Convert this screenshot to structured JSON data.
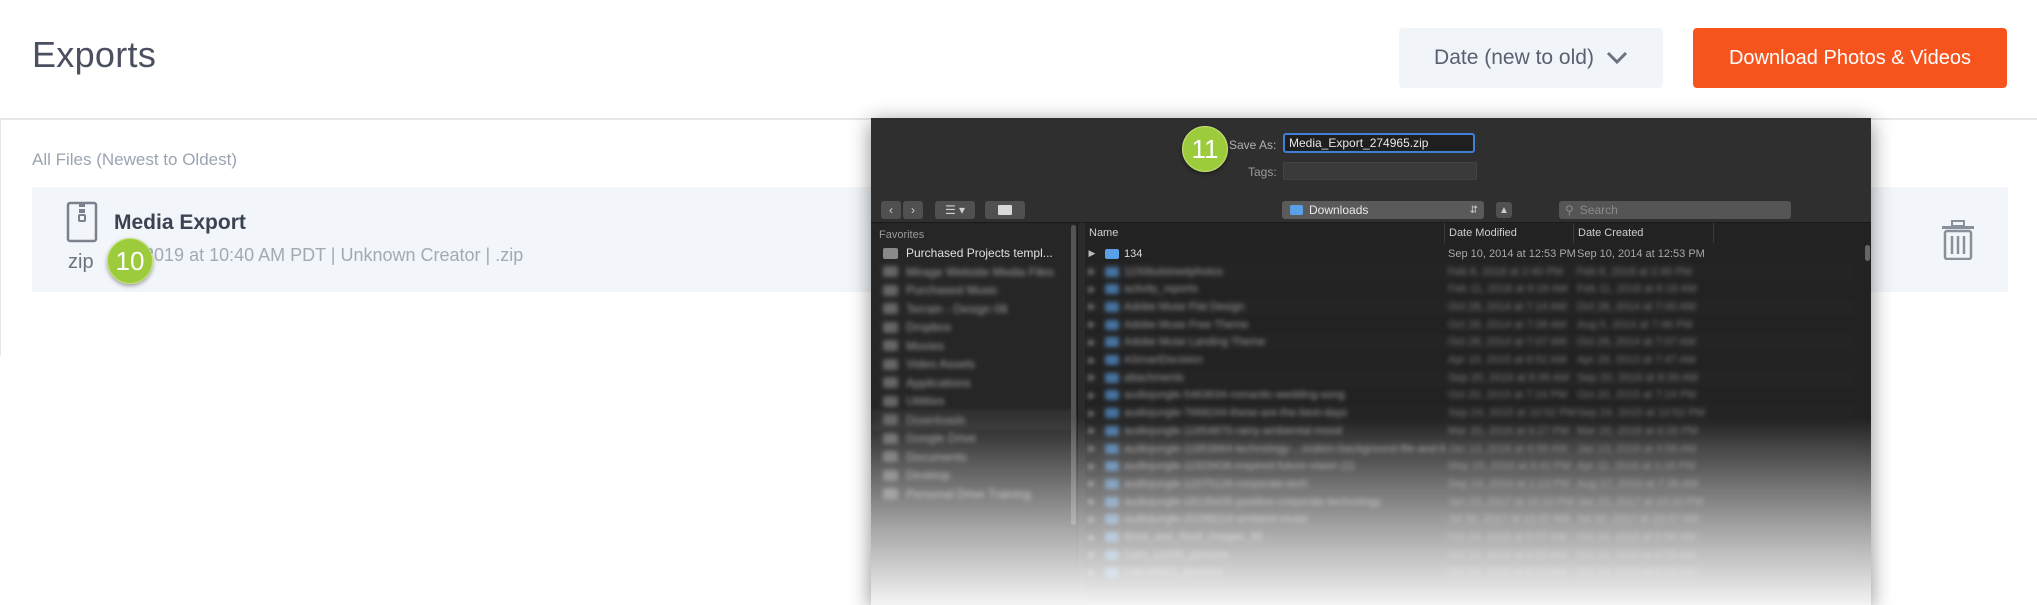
{
  "header": {
    "title": "Exports",
    "sort_label": "Date (new to old)",
    "download_label": "Download Photos & Videos",
    "accent": "#f7541d"
  },
  "list": {
    "label": "All Files (Newest to Oldest)",
    "file": {
      "name": "Media Export",
      "ext": "zip",
      "meta": "22, 2019 at 10:40 AM PDT | Unknown Creator | .zip"
    }
  },
  "badges": {
    "b10": "10",
    "b11": "11"
  },
  "dialog": {
    "save_as_label": "Save As:",
    "save_as_value": "Media_Export_274965.zip",
    "tags_label": "Tags:",
    "location": "Downloads",
    "search_placeholder": "Search",
    "sidebar_heading": "Favorites",
    "sidebar_items": [
      "Purchased Projects templ...",
      "Mirage Website Media Files",
      "Purchased Music",
      "Terrain - Design 08",
      "Dropbox",
      "Movies",
      "Video Assets",
      "Applications",
      "Utilities",
      "Downloads",
      "Google Drive",
      "Documents",
      "Desktop",
      "Personal Drive Training"
    ],
    "columns": {
      "name": "Name",
      "modified": "Date Modified",
      "created": "Date Created"
    },
    "rows": [
      {
        "name": "134",
        "modified": "Sep 10, 2014 at 12:53 PM",
        "created": "Sep 10, 2014 at 12:53 PM"
      },
      {
        "name": "1150bulstreetphotos",
        "modified": "Feb 8, 2018 at 2:40 PM",
        "created": "Feb 8, 2018 at 2:40 PM"
      },
      {
        "name": "activity_reports",
        "modified": "Feb 11, 2018 at 8:18 AM",
        "created": "Feb 11, 2018 at 8:18 AM"
      },
      {
        "name": "Adobe Muse Flat Design",
        "modified": "Oct 28, 2014 at 7:14 AM",
        "created": "Oct 28, 2014 at 7:00 AM"
      },
      {
        "name": "Adobe Muse Free Theme",
        "modified": "Oct 28, 2014 at 7:08 AM",
        "created": "Aug 5, 2014 at 7:46 PM"
      },
      {
        "name": "Adobe Muse Landing Theme",
        "modified": "Oct 28, 2014 at 7:07 AM",
        "created": "Oct 28, 2014 at 7:07 AM"
      },
      {
        "name": "ASmartDecision",
        "modified": "Apr 10, 2015 at 8:52 AM",
        "created": "Apr 29, 2013 at 7:47 AM"
      },
      {
        "name": "attachments",
        "modified": "Sep 20, 2016 at 8:39 AM",
        "created": "Sep 20, 2016 at 8:39 AM"
      },
      {
        "name": "audiojungle-5463634-romantic-wedding-song",
        "modified": "Oct 20, 2015 at 7:24 PM",
        "created": "Oct 20, 2015 at 7:24 PM"
      },
      {
        "name": "audiojungle-7668244-these-are-the-best-days",
        "modified": "Sep 24, 2015 at 10:52 PM",
        "created": "Sep 24, 2015 at 10:52 PM"
      },
      {
        "name": "audiojungle-11654870-rainy-ambiental-mood",
        "modified": "Mar 20, 2016 at 6:27 PM",
        "created": "Mar 20, 2016 at 6:26 PM"
      },
      {
        "name": "audiojungle-11853664-technology-...oration-background-file-and-license",
        "modified": "Jan 13, 2016 at 4:58 AM",
        "created": "Jan 13, 2016 at 4:58 AM"
      },
      {
        "name": "audiojungle-11929436-inspired-future-vision (1)",
        "modified": "May 15, 2016 at 6:42 PM",
        "created": "Apr 11, 2016 at 1:16 PM"
      },
      {
        "name": "audiojungle-12075126-corporate-tech",
        "modified": "Sep 14, 2016 at 1:13 PM",
        "created": "Aug 17, 2016 at 7:36 AM"
      },
      {
        "name": "audiojungle-18135435-positive-corporate-technology",
        "modified": "Jan 23, 2017 at 10:10 PM",
        "created": "Jan 22, 2017 at 10:10 PM"
      },
      {
        "name": "audiojungle-20288219-ambient-music",
        "modified": "Jul 30, 2017 at 10:37 AM",
        "created": "Jul 30, 2017 at 10:37 AM"
      },
      {
        "name": "Brick_and_Roof_Images_95",
        "modified": "Oct 24, 2016 at 6:57 AM",
        "created": "Oct 24, 2016 at 6:56 AM"
      },
      {
        "name": "Cam_12345_pictures",
        "modified": "Oct 24, 2016 at 6:55 AM",
        "created": "Oct 24, 2016 at 6:55 AM"
      },
      {
        "name": "Cam43322_pictures",
        "modified": "Oct 24, 2016 at 6:53 AM",
        "created": "Oct 24, 2016 at 6:53 AM"
      }
    ]
  }
}
